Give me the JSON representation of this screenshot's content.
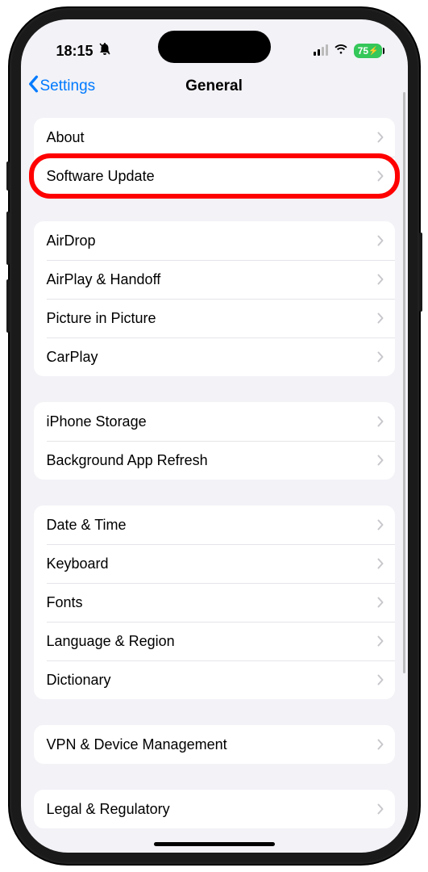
{
  "status": {
    "time": "18:15",
    "battery": "75"
  },
  "nav": {
    "back": "Settings",
    "title": "General"
  },
  "groups": [
    {
      "items": [
        {
          "label": "About",
          "name": "row-about"
        },
        {
          "label": "Software Update",
          "name": "row-software-update",
          "highlighted": true
        }
      ]
    },
    {
      "items": [
        {
          "label": "AirDrop",
          "name": "row-airdrop"
        },
        {
          "label": "AirPlay & Handoff",
          "name": "row-airplay-handoff"
        },
        {
          "label": "Picture in Picture",
          "name": "row-pip"
        },
        {
          "label": "CarPlay",
          "name": "row-carplay"
        }
      ]
    },
    {
      "items": [
        {
          "label": "iPhone Storage",
          "name": "row-iphone-storage"
        },
        {
          "label": "Background App Refresh",
          "name": "row-background-refresh"
        }
      ]
    },
    {
      "items": [
        {
          "label": "Date & Time",
          "name": "row-date-time"
        },
        {
          "label": "Keyboard",
          "name": "row-keyboard"
        },
        {
          "label": "Fonts",
          "name": "row-fonts"
        },
        {
          "label": "Language & Region",
          "name": "row-language-region"
        },
        {
          "label": "Dictionary",
          "name": "row-dictionary"
        }
      ]
    },
    {
      "items": [
        {
          "label": "VPN & Device Management",
          "name": "row-vpn-device"
        }
      ]
    },
    {
      "items": [
        {
          "label": "Legal & Regulatory",
          "name": "row-legal-regulatory"
        }
      ]
    }
  ]
}
